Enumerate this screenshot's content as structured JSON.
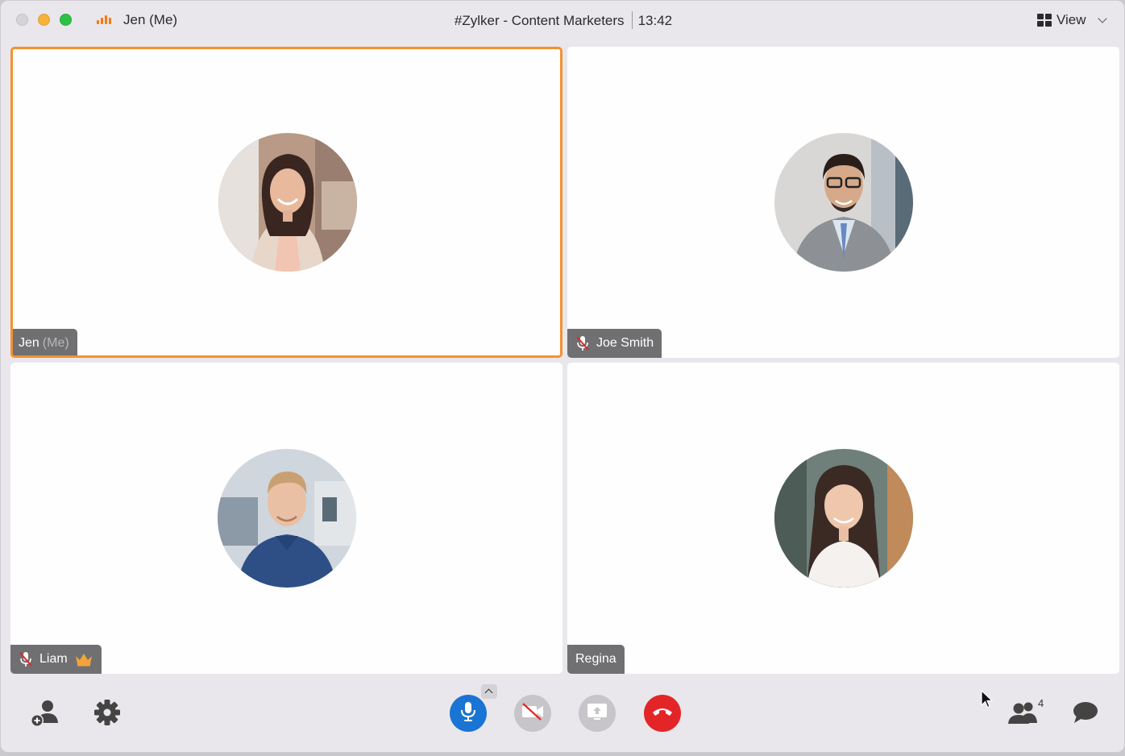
{
  "window": {
    "user_label": "Jen (Me)",
    "meeting_title": "#Zylker - Content Marketers",
    "timer": "13:42",
    "view_label": "View",
    "traffic_lights": {
      "close": "#d6d4d9",
      "minimize": "#f5b33b",
      "maximize": "#2fc145"
    }
  },
  "colors": {
    "active_speaker_border": "#f39131",
    "mic_button": "#1a74d4",
    "end_call_button": "#e32528",
    "name_tag_bg": "#707073"
  },
  "participants": [
    {
      "name": "Jen",
      "suffix": "(Me)",
      "muted": false,
      "host": false,
      "active": true
    },
    {
      "name": "Joe Smith",
      "suffix": "",
      "muted": true,
      "host": false,
      "active": false
    },
    {
      "name": "Liam",
      "suffix": "",
      "muted": true,
      "host": true,
      "active": false
    },
    {
      "name": "Regina",
      "suffix": "",
      "muted": false,
      "host": false,
      "active": false
    }
  ],
  "toolbar": {
    "left_icons": [
      "add-participant-icon",
      "settings-gear-icon"
    ],
    "center_buttons": [
      "microphone-icon",
      "video-off-icon",
      "screen-share-icon",
      "end-call-icon"
    ],
    "right_icons": [
      "participants-icon",
      "chat-bubble-icon"
    ],
    "participants_count": "4"
  }
}
